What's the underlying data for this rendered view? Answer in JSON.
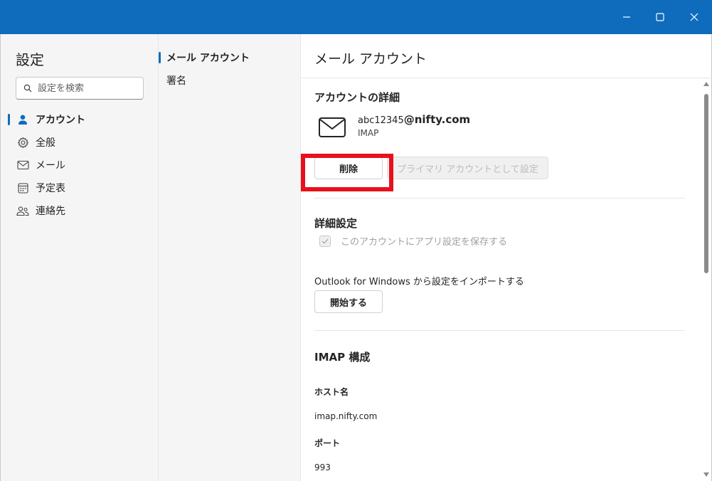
{
  "window": {
    "accent": "#0f6cbd",
    "controls": [
      "minimize-icon",
      "maximize-icon",
      "close-icon"
    ]
  },
  "leftnav": {
    "title": "設定",
    "search_placeholder": "設定を検索",
    "items": [
      {
        "label": "アカウント",
        "icon": "person-icon",
        "selected": true
      },
      {
        "label": "全般",
        "icon": "gear-icon",
        "selected": false
      },
      {
        "label": "メール",
        "icon": "mail-icon",
        "selected": false
      },
      {
        "label": "予定表",
        "icon": "calendar-icon",
        "selected": false
      },
      {
        "label": "連絡先",
        "icon": "people-icon",
        "selected": false
      }
    ]
  },
  "midnav": {
    "items": [
      {
        "label": "メール アカウント",
        "selected": true
      },
      {
        "label": "署名",
        "selected": false
      }
    ]
  },
  "content": {
    "title": "メール アカウント",
    "details_title": "アカウントの詳細",
    "account": {
      "email_user": "abc12345",
      "email_domain": "@nifty.com",
      "type": "IMAP"
    },
    "delete_label": "削除",
    "primary_label": "プライマリ アカウントとして設定",
    "advanced_title": "詳細設定",
    "save_settings_label": "このアカウントにアプリ設定を保存する",
    "import_text": "Outlook for Windows から設定をインポートする",
    "start_label": "開始する",
    "imap_title": "IMAP 構成",
    "host_label": "ホスト名",
    "host_value": "imap.nifty.com",
    "port_label": "ポート",
    "port_value": "993",
    "highlight_color": "#e8101c"
  }
}
